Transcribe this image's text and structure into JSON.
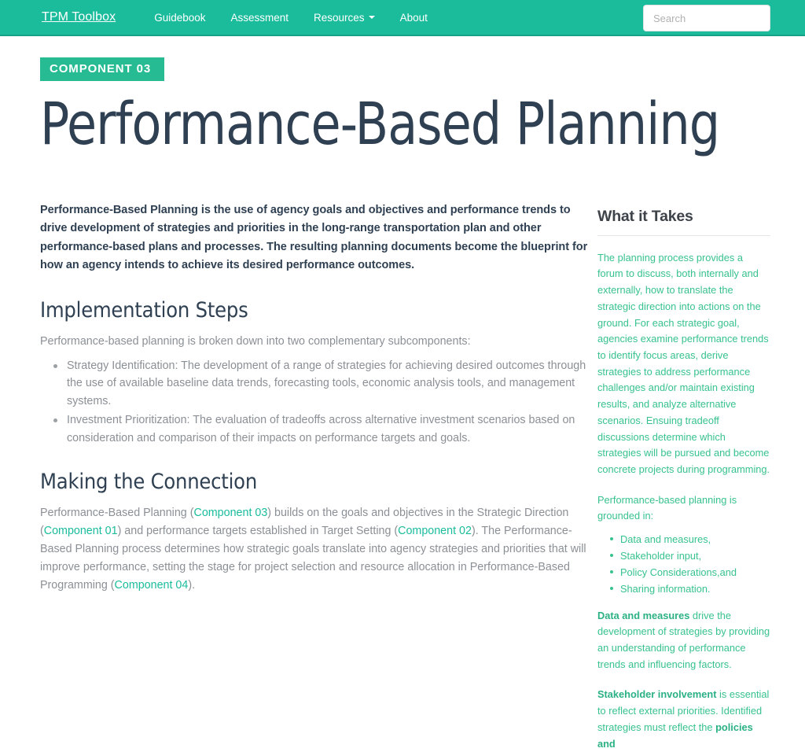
{
  "navbar": {
    "brand": "TPM Toolbox",
    "links": [
      {
        "label": "Guidebook",
        "has_caret": false
      },
      {
        "label": "Assessment",
        "has_caret": false
      },
      {
        "label": "Resources",
        "has_caret": true
      },
      {
        "label": "About",
        "has_caret": false
      }
    ],
    "search_placeholder": "Search",
    "search_value": "",
    "background_color": "#1abc9c"
  },
  "header": {
    "badge": "COMPONENT 03",
    "badge_color": "#26bb93",
    "title": "Performance-Based Planning",
    "title_color": "#2f4052"
  },
  "main": {
    "lead": "Performance-Based Planning is the use of agency goals and objectives and performance trends to drive development of strategies and priorities in the long-range transportation plan and other performance-based plans and processes. The resulting planning documents become the blueprint for how an agency intends to achieve its desired performance outcomes.",
    "implementation": {
      "heading": "Implementation Steps",
      "intro": "Performance-based planning is broken down into two complementary subcomponents:",
      "bullets": [
        "Strategy Identification: The development of a range of strategies for achieving desired outcomes through the use of available baseline data trends, forecasting tools, economic analysis tools, and management systems.",
        "Investment Prioritization: The evaluation of tradeoffs across alternative investment scenarios based on consideration and comparison of their impacts on performance targets and goals."
      ]
    },
    "connection": {
      "heading": "Making the Connection",
      "p1_a": "Performance-Based Planning (",
      "p1_link1": "Component 03",
      "p1_b": ") builds on the goals and objectives in the Strategic Direction (",
      "p1_link2": "Component 01",
      "p1_c": ") and performance targets established in Target Setting (",
      "p1_link3": "Component 02",
      "p1_d": "). The Performance-Based Planning process determines how strategic goals translate into agency strategies and priorities that will improve performance, setting the stage for project selection and resource allocation in Performance-Based Programming (",
      "p1_link4": "Component 04",
      "p1_e": ")."
    },
    "link_color": "#1abc9c"
  },
  "sidebar": {
    "heading": "What it Takes",
    "text_color": "#37c28f",
    "p1": "The planning process provides a forum to discuss, both internally and externally, how to translate the strategic direction into actions on the ground. For each strategic goal, agencies examine performance trends to identify focus areas, derive strategies to address performance challenges and/or maintain existing results, and analyze alternative scenarios. Ensuing tradeoff discussions determine which strategies will be pursued and become concrete projects during programming.",
    "p2": "Performance-based planning is grounded in:",
    "bullets": [
      "Data and measures,",
      "Stakeholder input,",
      "Policy Considerations,and",
      "Sharing information."
    ],
    "p3_strong": "Data and measures",
    "p3_rest": " drive the development of strategies by providing an understanding of performance trends and influencing factors.",
    "p4_strong": "Stakeholder involvement",
    "p4_mid": " is essential to reflect external priorities. Identified strategies must reflect the ",
    "p4_strong2": "policies and"
  }
}
